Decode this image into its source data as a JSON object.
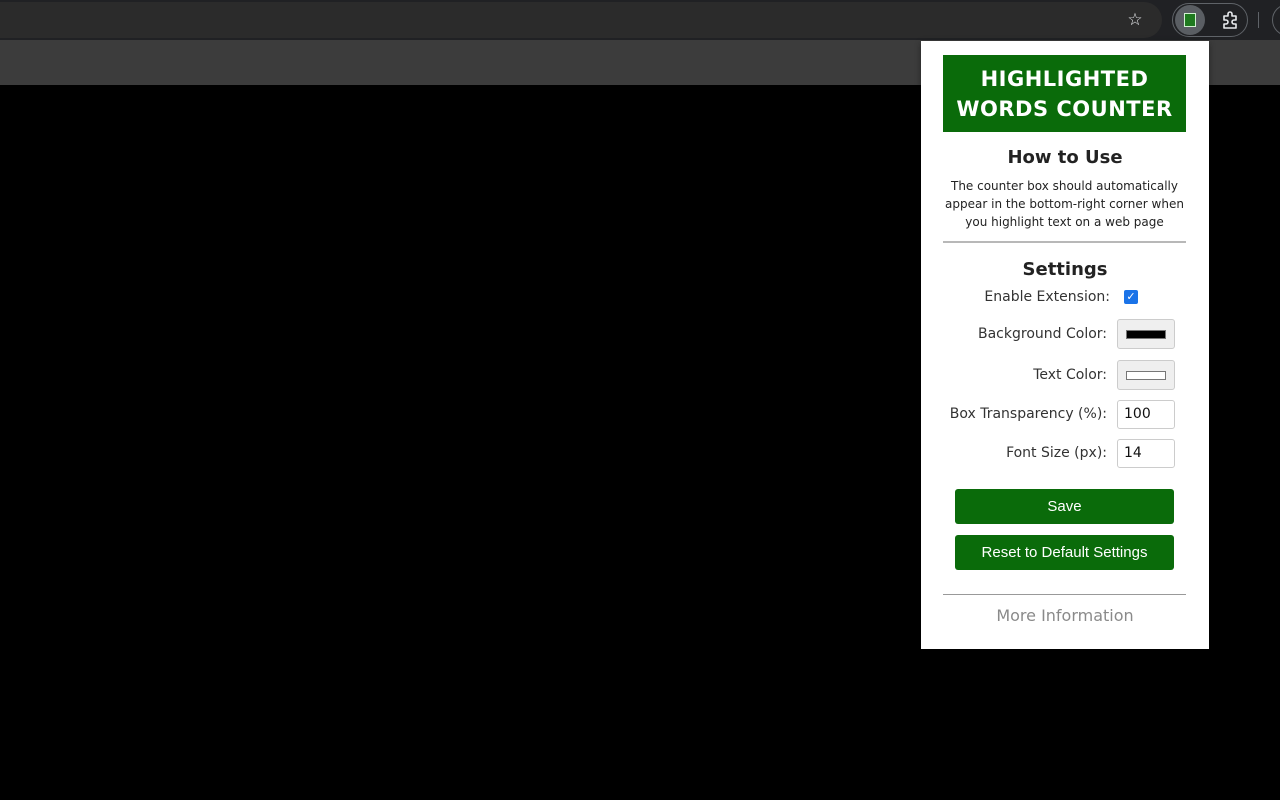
{
  "browser": {
    "bookmark_icon": "star-icon",
    "extension_icon": "highlighted-words-counter-icon",
    "extensions_menu_icon": "puzzle-icon"
  },
  "popup": {
    "banner_line1": "HIGHLIGHTED",
    "banner_line2": "WORDS COUNTER",
    "howto_title": "How to Use",
    "howto_desc": "The counter box should automatically appear in the bottom-right corner when you highlight text on a web page",
    "settings_title": "Settings",
    "enable_label": "Enable Extension:",
    "enable_checked": true,
    "bg_color_label": "Background Color:",
    "bg_color_value": "#000000",
    "text_color_label": "Text Color:",
    "text_color_value": "#ffffff",
    "transparency_label": "Box Transparency (%):",
    "transparency_value": "100",
    "font_size_label": "Font Size (px):",
    "font_size_value": "14",
    "save_label": "Save",
    "reset_label": "Reset to Default Settings",
    "more_info_label": "More Information"
  },
  "colors": {
    "brand_green": "#0a6b0a",
    "checkbox_blue": "#1a73e8"
  }
}
